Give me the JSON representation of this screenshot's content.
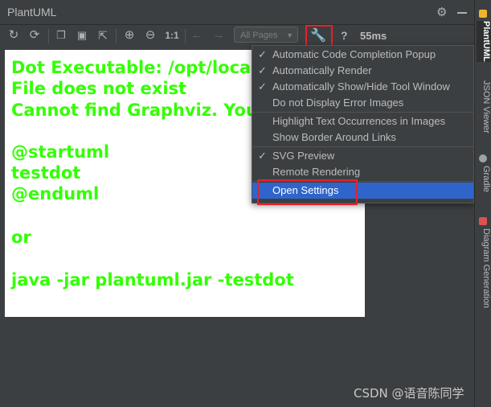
{
  "window": {
    "title": "PlantUML"
  },
  "toolbar": {
    "zoom_actual": "1:1",
    "pages_select": "All Pages",
    "help": "?",
    "render_time": "55ms"
  },
  "preview": {
    "lines": [
      "Dot Executable: /opt/loca",
      "File does not exist",
      "Cannot find Graphviz. You",
      "@startuml",
      "testdot",
      "@enduml",
      " or",
      "java -jar plantuml.jar -testdot"
    ],
    "text_color": "#33ff02"
  },
  "menu": {
    "items": [
      {
        "label": "Automatic Code Completion Popup",
        "checked": "✓"
      },
      {
        "label": "Automatically Render",
        "checked": "✓"
      },
      {
        "label": "Automatically Show/Hide Tool Window",
        "checked": "✓"
      },
      {
        "label": "Do not Display Error Images",
        "checked": ""
      },
      {
        "label": "Highlight Text Occurrences in Images",
        "checked": ""
      },
      {
        "label": "Show Border Around Links",
        "checked": ""
      },
      {
        "label": "SVG Preview",
        "checked": "✓"
      },
      {
        "label": "Remote Rendering",
        "checked": ""
      },
      {
        "label": "Open Settings",
        "checked": ""
      }
    ],
    "selected_color": "#2f65ca"
  },
  "sidebar": {
    "tabs": [
      {
        "label": "PlantUML",
        "icon": "plantuml-icon"
      },
      {
        "label": "JSON Viewer",
        "icon": ""
      },
      {
        "label": "Gradle",
        "icon": "gradle-icon"
      },
      {
        "label": "Diagram Generation",
        "icon": "diagram-icon"
      }
    ]
  },
  "watermark": "CSDN @语音陈同学",
  "highlight_color": "#e8202a"
}
